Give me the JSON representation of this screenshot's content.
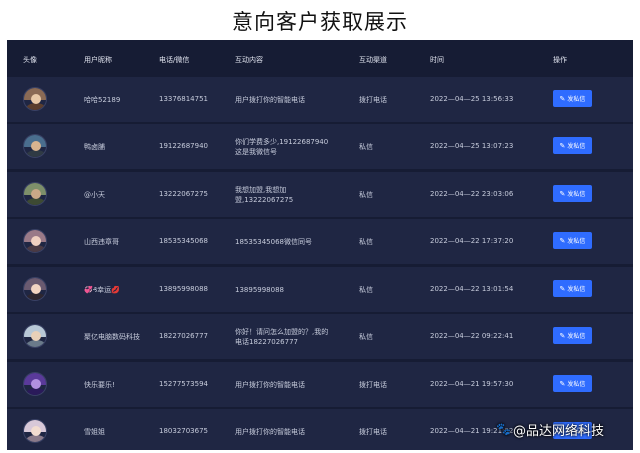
{
  "page": {
    "title": "意向客户获取展示"
  },
  "table": {
    "headers": {
      "avatar": "头像",
      "nickname": "用户昵称",
      "phone": "电话/微信",
      "content": "互动内容",
      "channel": "互动渠道",
      "time": "时间",
      "action": "操作"
    },
    "rows": [
      {
        "nickname": "哈哈52189",
        "phone": "13376814751",
        "content": "用户拨打你的智能电话",
        "channel": "拨打电话",
        "time": "2022—04—25 13:56:33",
        "action": "发私信"
      },
      {
        "nickname": "鸭卤脯",
        "phone": "19122687940",
        "content": "你们学费多少,19122687940这是我微信号",
        "channel": "私信",
        "time": "2022—04—25 13:07:23",
        "action": "发私信"
      },
      {
        "nickname": "@小天",
        "phone": "13222067275",
        "content": "我想加盟,我想加盟,13222067275",
        "channel": "私信",
        "time": "2022—04—22 23:03:06",
        "action": "发私信"
      },
      {
        "nickname": "山西违章哥",
        "phone": "18535345068",
        "content": "18535345068微信同号",
        "channel": "私信",
        "time": "2022—04—22 17:37:20",
        "action": "发私信"
      },
      {
        "nickname": "💞₰幸运💋",
        "phone": "13895998088",
        "content": "13895998088",
        "channel": "私信",
        "time": "2022—04—22 13:01:54",
        "action": "发私信"
      },
      {
        "nickname": "聚亿电脑数码科技",
        "phone": "18227026777",
        "content": "你好！请问怎么加盟的？,我的电话18227026777",
        "channel": "私信",
        "time": "2022—04—22 09:22:41",
        "action": "发私信"
      },
      {
        "nickname": "快乐要乐!",
        "phone": "15277573594",
        "content": "用户拨打你的智能电话",
        "channel": "拨打电话",
        "time": "2022—04—21 19:57:30",
        "action": "发私信"
      },
      {
        "nickname": "雪姐姐",
        "phone": "18032703675",
        "content": "用户拨打你的智能电话",
        "channel": "拨打电话",
        "time": "2022—04—21 19:21:02",
        "action": "发私信"
      }
    ]
  },
  "watermark": {
    "text": "@品达网络科技",
    "icon": "paw-icon"
  },
  "colors": {
    "panel_bg": "#161c34",
    "row_bg": "#1f2643",
    "button": "#2f6cff"
  }
}
